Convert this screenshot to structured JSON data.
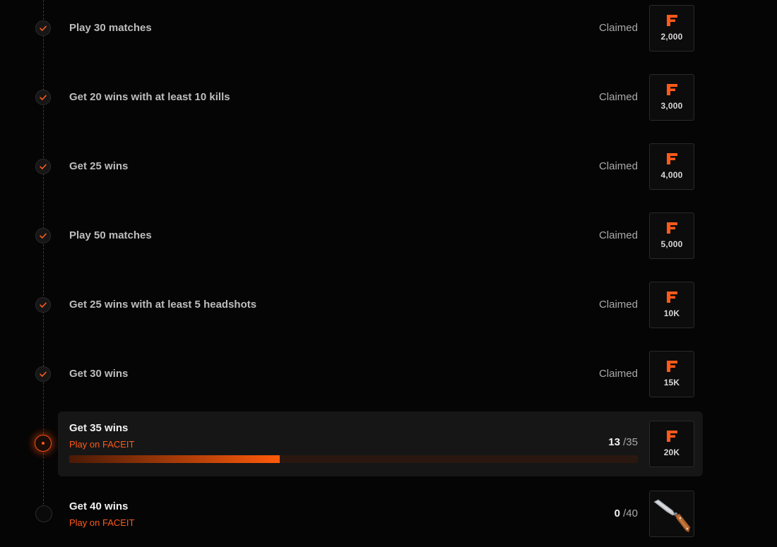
{
  "colors": {
    "accent": "#ff5a1a",
    "background": "#050505",
    "panel": "#161616"
  },
  "missions": [
    {
      "title": "Play 30 matches",
      "status": "Claimed",
      "reward": {
        "icon": "faceit-points-icon",
        "amount": "2,000"
      }
    },
    {
      "title": "Get 20 wins with at least 10 kills",
      "status": "Claimed",
      "reward": {
        "icon": "faceit-points-icon",
        "amount": "3,000"
      }
    },
    {
      "title": "Get 25 wins",
      "status": "Claimed",
      "reward": {
        "icon": "faceit-points-icon",
        "amount": "4,000"
      }
    },
    {
      "title": "Play 50 matches",
      "status": "Claimed",
      "reward": {
        "icon": "faceit-points-icon",
        "amount": "5,000"
      }
    },
    {
      "title": "Get 25 wins with at least 5 headshots",
      "status": "Claimed",
      "reward": {
        "icon": "faceit-points-icon",
        "amount": "10K"
      }
    },
    {
      "title": "Get 30 wins",
      "status": "Claimed",
      "reward": {
        "icon": "faceit-points-icon",
        "amount": "15K"
      }
    }
  ],
  "active_mission": {
    "title": "Get 35 wins",
    "subtitle": "Play on FACEIT",
    "progress_current": "13",
    "progress_total": "/35",
    "progress_fraction": 0.37,
    "reward": {
      "icon": "faceit-points-icon",
      "amount": "20K"
    }
  },
  "next_mission": {
    "title": "Get 40 wins",
    "subtitle": "Play on FACEIT",
    "progress_current": "0",
    "progress_total": "/40",
    "reward": {
      "icon": "knife-icon"
    }
  }
}
